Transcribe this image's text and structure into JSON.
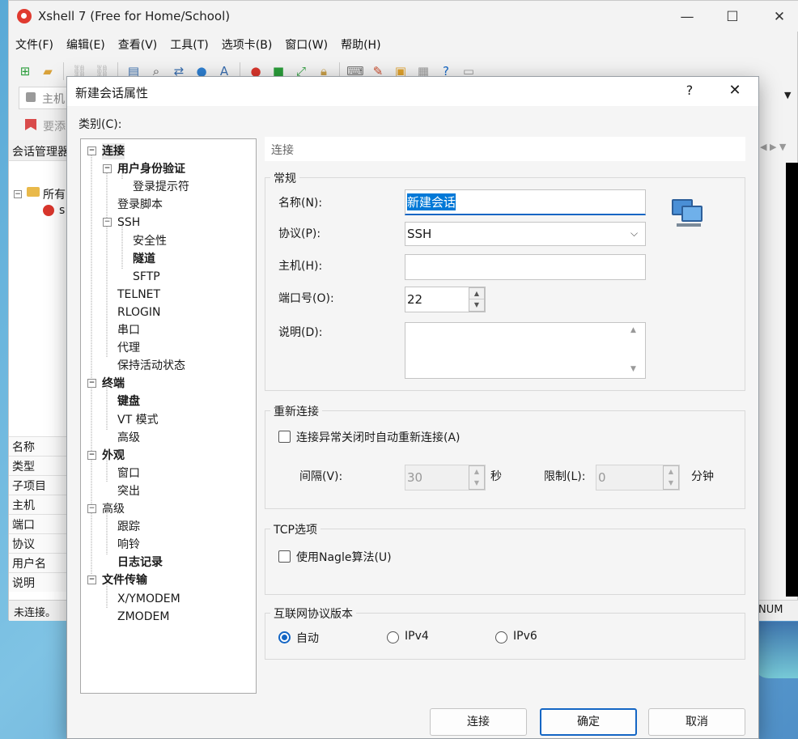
{
  "app": {
    "title": "Xshell 7 (Free for Home/School)",
    "menu": [
      "文件(F)",
      "编辑(E)",
      "查看(V)",
      "工具(T)",
      "选项卡(B)",
      "窗口(W)",
      "帮助(H)"
    ],
    "address_label": "主机",
    "hint_label": "要添",
    "session_manager_title": "会话管理器",
    "tree_folder": "所有",
    "tree_session": "s",
    "props": [
      "名称",
      "类型",
      "子项目",
      "主机",
      "端口",
      "协议",
      "用户名",
      "说明"
    ],
    "status": "未连接。",
    "status_num": "NUM"
  },
  "dialog": {
    "title": "新建会话属性",
    "help_label": "?",
    "close_label": "✕",
    "category_label": "类别(C):",
    "tree": [
      {
        "label": "连接",
        "bold": true,
        "selected": true,
        "toggle": "−"
      },
      {
        "label": "用户身份验证",
        "bold": true,
        "toggle": "−"
      },
      {
        "label": "登录提示符"
      },
      {
        "label": "登录脚本"
      },
      {
        "label": "SSH",
        "toggle": "−"
      },
      {
        "label": "安全性"
      },
      {
        "label": "隧道",
        "bold": true
      },
      {
        "label": "SFTP"
      },
      {
        "label": "TELNET"
      },
      {
        "label": "RLOGIN"
      },
      {
        "label": "串口"
      },
      {
        "label": "代理"
      },
      {
        "label": "保持活动状态"
      },
      {
        "label": "终端",
        "bold": true,
        "toggle": "−"
      },
      {
        "label": "键盘",
        "bold": true
      },
      {
        "label": "VT 模式"
      },
      {
        "label": "高级"
      },
      {
        "label": "外观",
        "bold": true,
        "toggle": "−"
      },
      {
        "label": "窗口"
      },
      {
        "label": "突出"
      },
      {
        "label": "高级",
        "toggle": "−"
      },
      {
        "label": "跟踪"
      },
      {
        "label": "响铃"
      },
      {
        "label": "日志记录",
        "bold": true
      },
      {
        "label": "文件传输",
        "bold": true,
        "toggle": "−"
      },
      {
        "label": "X/YMODEM"
      },
      {
        "label": "ZMODEM"
      }
    ],
    "section_title": "连接",
    "general": {
      "title": "常规",
      "name_label": "名称(N):",
      "name_value": "新建会话",
      "protocol_label": "协议(P):",
      "protocol_value": "SSH",
      "host_label": "主机(H):",
      "host_value": "",
      "port_label": "端口号(O):",
      "port_value": "22",
      "desc_label": "说明(D):",
      "desc_value": ""
    },
    "reconnect": {
      "title": "重新连接",
      "auto_label": "连接异常关闭时自动重新连接(A)",
      "auto_checked": false,
      "interval_label": "间隔(V):",
      "interval_value": "30",
      "interval_unit": "秒",
      "limit_label": "限制(L):",
      "limit_value": "0",
      "limit_unit": "分钟"
    },
    "tcp": {
      "title": "TCP选项",
      "nagle_label": "使用Nagle算法(U)",
      "nagle_checked": false
    },
    "ipver": {
      "title": "互联网协议版本",
      "options": [
        "自动",
        "IPv4",
        "IPv6"
      ],
      "selected": "自动"
    },
    "buttons": {
      "connect": "连接",
      "ok": "确定",
      "cancel": "取消"
    }
  },
  "colors": {
    "accent": "#1466c4",
    "selection": "#0078d7"
  }
}
